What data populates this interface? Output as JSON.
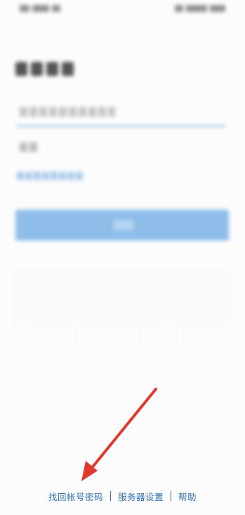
{
  "footer": {
    "find_account_password": "找回帐号密码",
    "server_settings": "服务器设置",
    "help": "帮助",
    "link_color": "#2f6fb2"
  },
  "login_button": {
    "color": "#8fbde9"
  },
  "annotation": {
    "arrow_color": "#e03a2f"
  }
}
